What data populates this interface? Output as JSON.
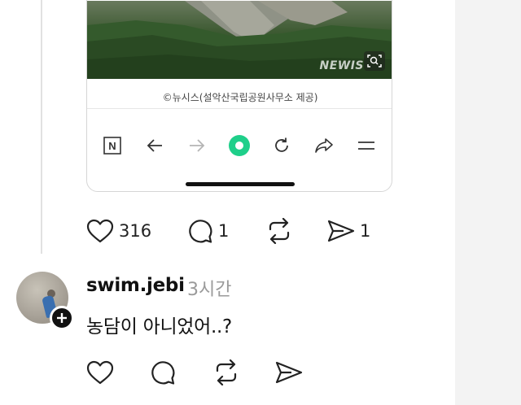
{
  "post": {
    "photo": {
      "watermark": "NEWIS",
      "caption": "©뉴시스(설악산국립공원사무소 제공)"
    },
    "browser_bar": {
      "icons": [
        "naver-n-icon",
        "back-arrow-icon",
        "forward-arrow-icon",
        "green-dot-icon",
        "refresh-icon",
        "share-icon",
        "menu-icon"
      ],
      "n_label": "N"
    },
    "actions": {
      "likes": "316",
      "comments": "1",
      "shares": "1"
    }
  },
  "reply": {
    "username": "swim.jebi",
    "time": "3시간",
    "text": "농담이 아니었어..?"
  },
  "colors": {
    "accent_green": "#1fcf8a",
    "text_primary": "#111111",
    "text_secondary": "#9a9a9a",
    "icon": "#222222"
  }
}
